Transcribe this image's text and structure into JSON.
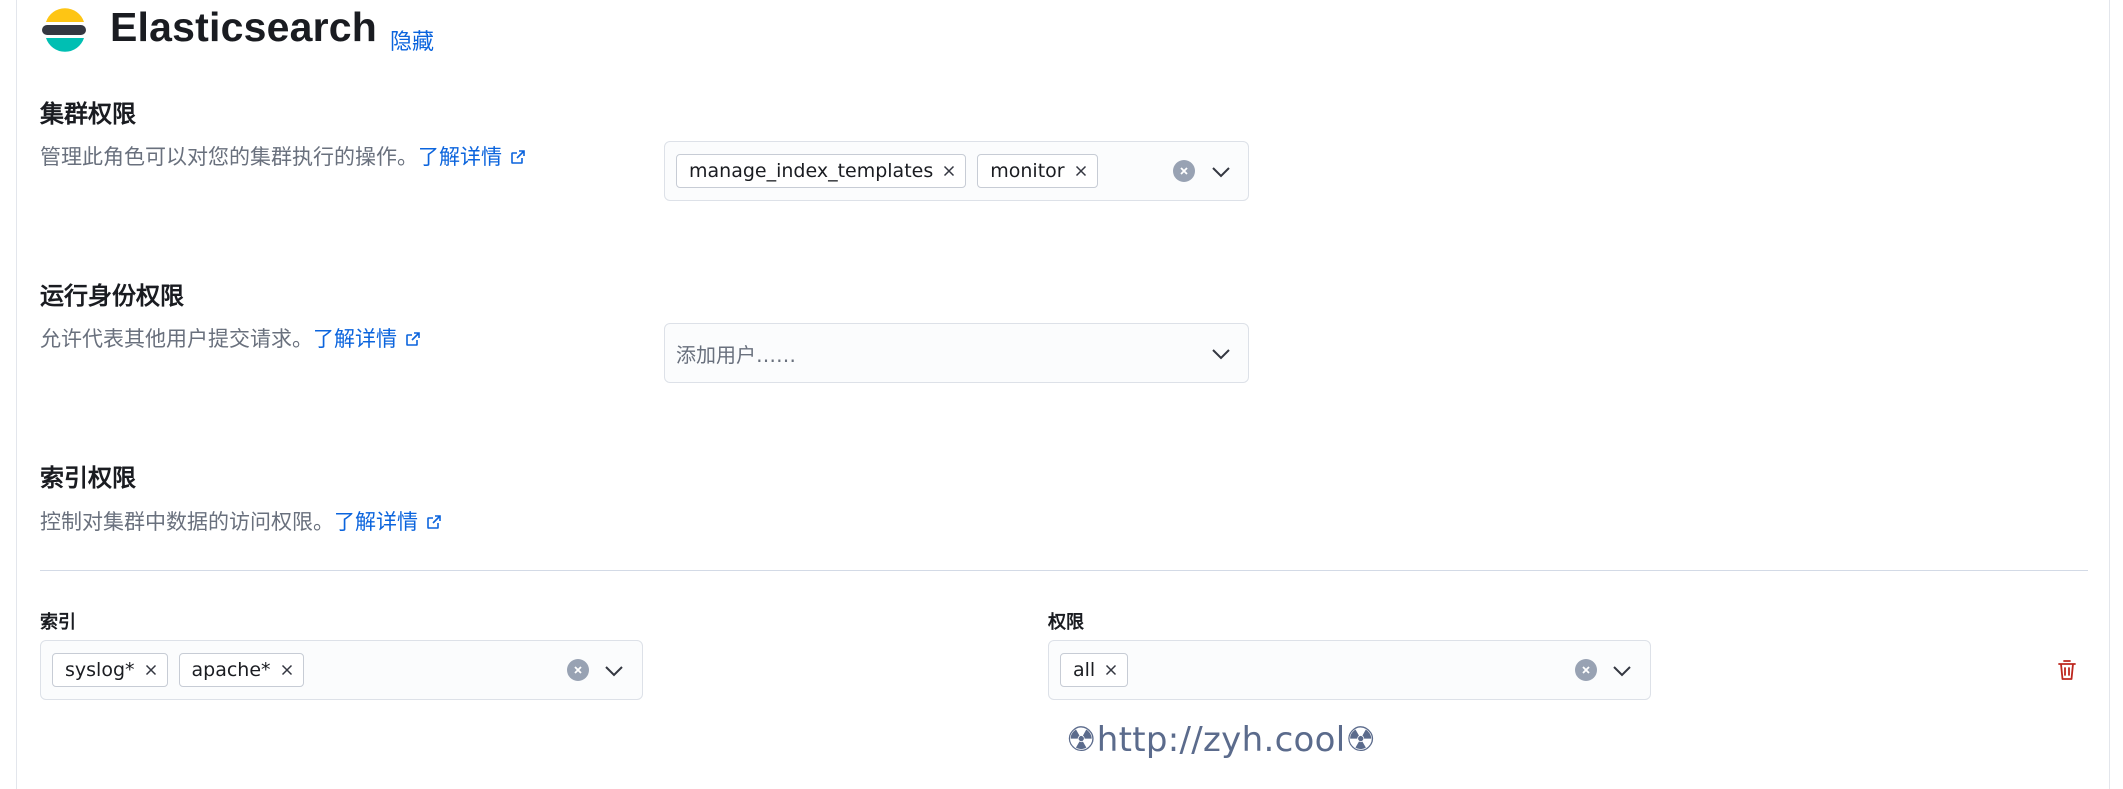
{
  "header": {
    "title": "Elasticsearch",
    "hide_link": "隐藏"
  },
  "cluster": {
    "title": "集群权限",
    "desc": "管理此角色可以对您的集群执行的操作。",
    "learn_more": "了解详情",
    "selected": [
      "manage_index_templates",
      "monitor"
    ]
  },
  "run_as": {
    "title": "运行身份权限",
    "desc": "允许代表其他用户提交请求。",
    "learn_more": "了解详情",
    "placeholder": "添加用户……"
  },
  "index": {
    "title": "索引权限",
    "desc": "控制对集群中数据的访问权限。",
    "learn_more": "了解详情",
    "indices_label": "索引",
    "indices": [
      "syslog*",
      "apache*"
    ],
    "privileges_label": "权限",
    "privileges": [
      "all"
    ]
  },
  "watermark": "☢http://zyh.cool☢",
  "colors": {
    "link": "#0b64dd",
    "danger": "#bd271e",
    "logo_yellow": "#fec514",
    "logo_dark": "#343741",
    "logo_teal": "#00bfb3"
  }
}
